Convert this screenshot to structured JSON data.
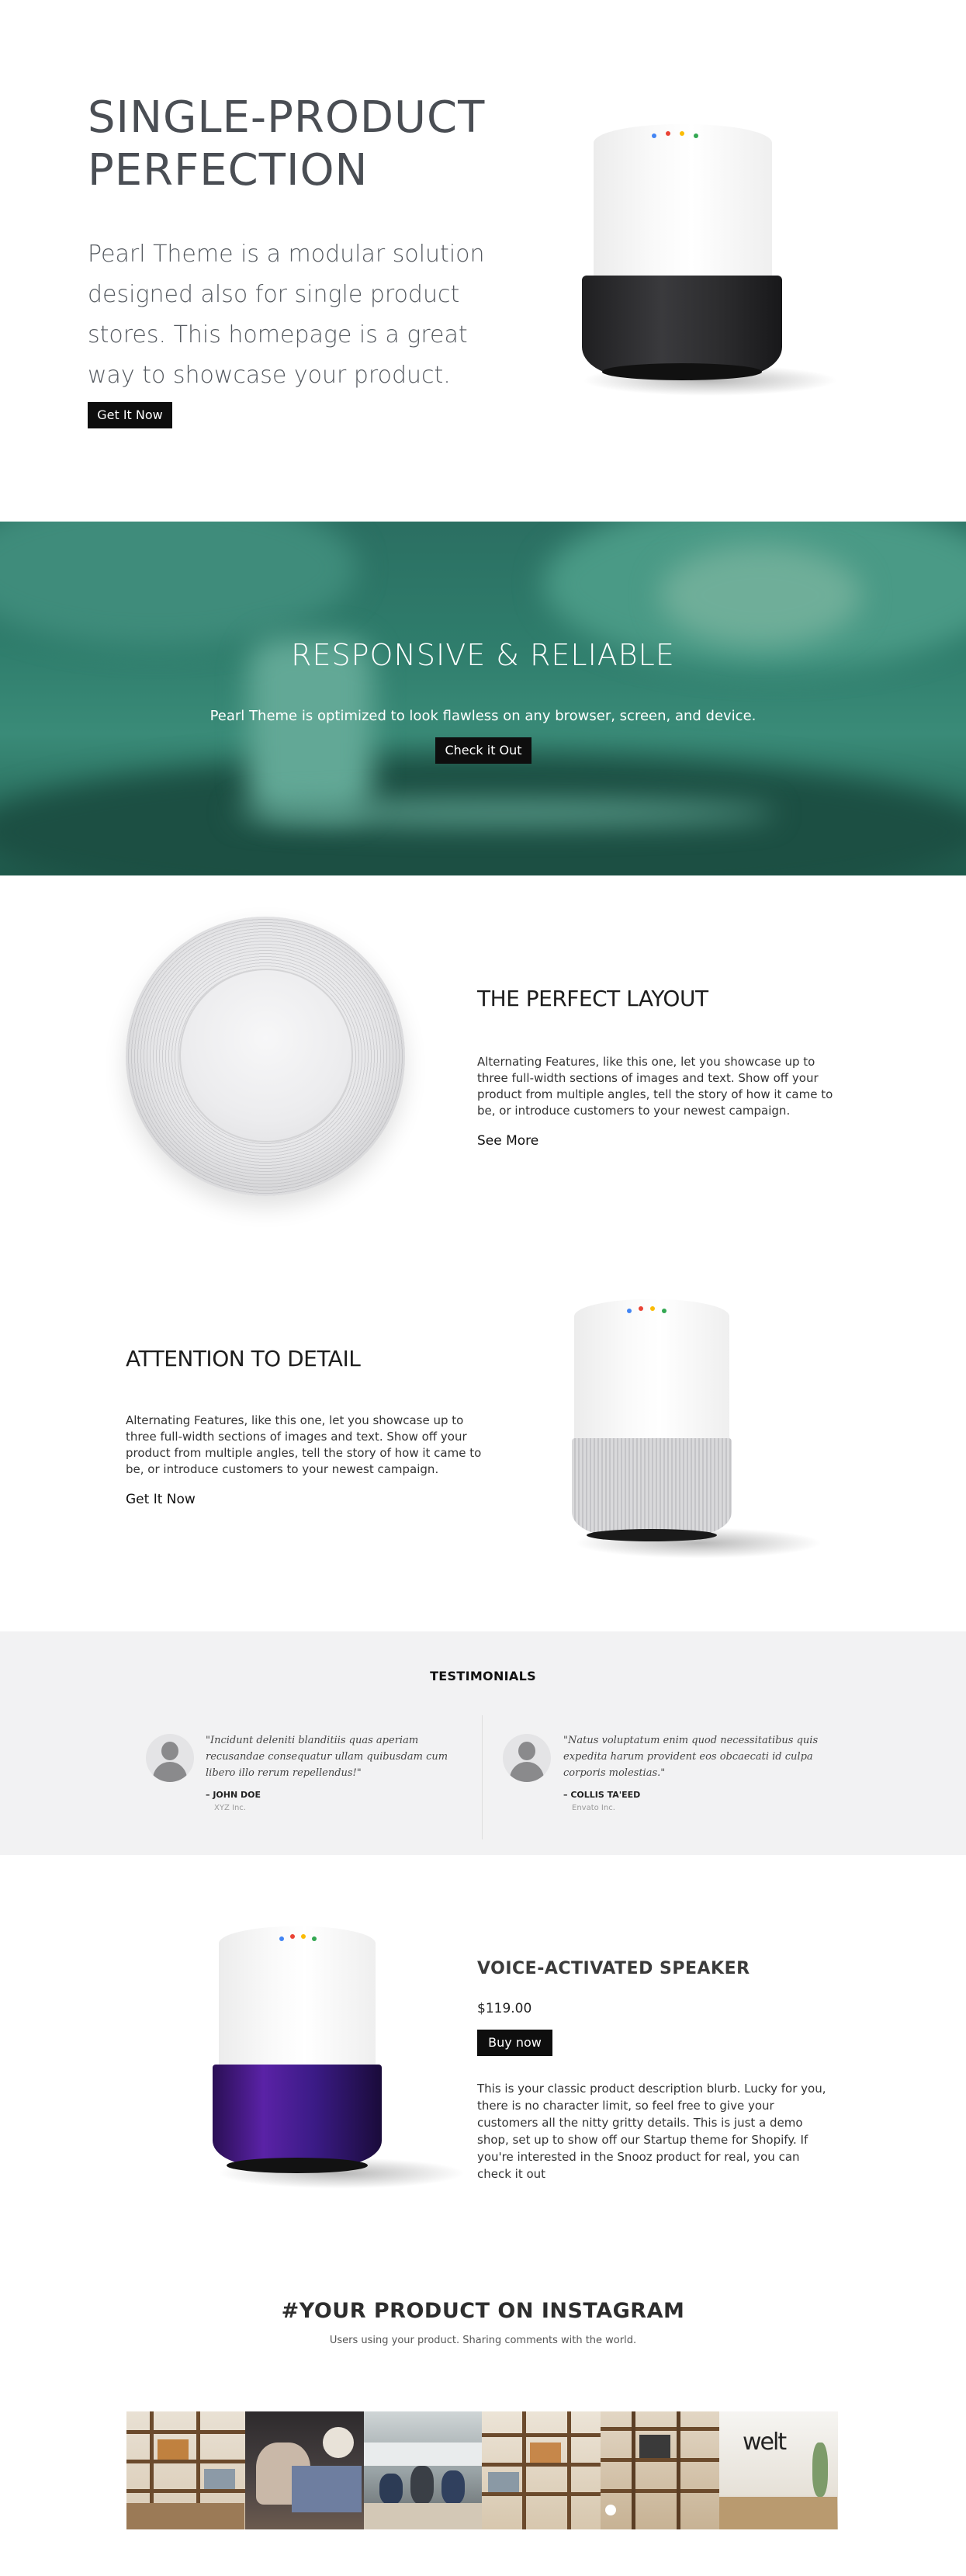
{
  "hero": {
    "title_line1": "SINGLE-PRODUCT",
    "title_line2": "PERFECTION",
    "text": "Pearl Theme is a modular solution designed also for single product stores. This homepage is a great way to showcase your product.",
    "button": "Get It Now"
  },
  "banner": {
    "title": "RESPONSIVE & RELIABLE",
    "text": "Pearl Theme is optimized to look flawless on any browser, screen, and device.",
    "button": "Check it Out"
  },
  "feature1": {
    "title": "THE PERFECT LAYOUT",
    "text": "Alternating Features, like this one, let you showcase up to three full-width sections of images and text. Show off your product from multiple angles, tell the story of how it came to be, or introduce customers to your newest campaign.",
    "link": "See More"
  },
  "feature2": {
    "title": "ATTENTION TO DETAIL",
    "text": "Alternating Features, like this one, let you showcase up to three full-width sections of images and text. Show off your product from multiple angles, tell the story of how it came to be, or introduce customers to your newest campaign.",
    "link": "Get It Now"
  },
  "testimonials": {
    "heading": "TESTIMONIALS",
    "items": [
      {
        "quote": "\"Incidunt deleniti blanditiis quas aperiam recusandae consequatur ullam quibusdam cum libero illo rerum repellendus!\"",
        "author": "– JOHN DOE",
        "company": "XYZ Inc."
      },
      {
        "quote": "\"Natus voluptatum enim quod necessitatibus quis expedita harum provident eos obcaecati id culpa corporis molestias.\"",
        "author": "– COLLIS TA'EED",
        "company": "Envato Inc."
      }
    ]
  },
  "product": {
    "title": "VOICE-ACTIVATED SPEAKER",
    "price": "$119.00",
    "button": "Buy now",
    "description": "This is your classic product description blurb. Lucky for you, there is no character limit, so feel free to give your customers all the nitty gritty details. This is just a demo shop, set up to show off our Startup theme for Shopify. If you're interested in the Snooz product for real, you can check it out"
  },
  "instagram": {
    "title": "#YOUR PRODUCT ON INSTAGRAM",
    "subtitle": "Users using your product. Sharing comments with the world.",
    "logo_text": "welt"
  },
  "colors": {
    "button_bg": "#0e0e0e",
    "band_teal": "#2f7d6c",
    "testimonials_bg": "#f2f2f3",
    "speaker_dark": "#2a2a2c",
    "speaker_grey": "#cfcfd1",
    "speaker_purple": "#4a1c8c",
    "led_colors": [
      "#4285f4",
      "#ea4335",
      "#fbbc05",
      "#34a853"
    ]
  }
}
